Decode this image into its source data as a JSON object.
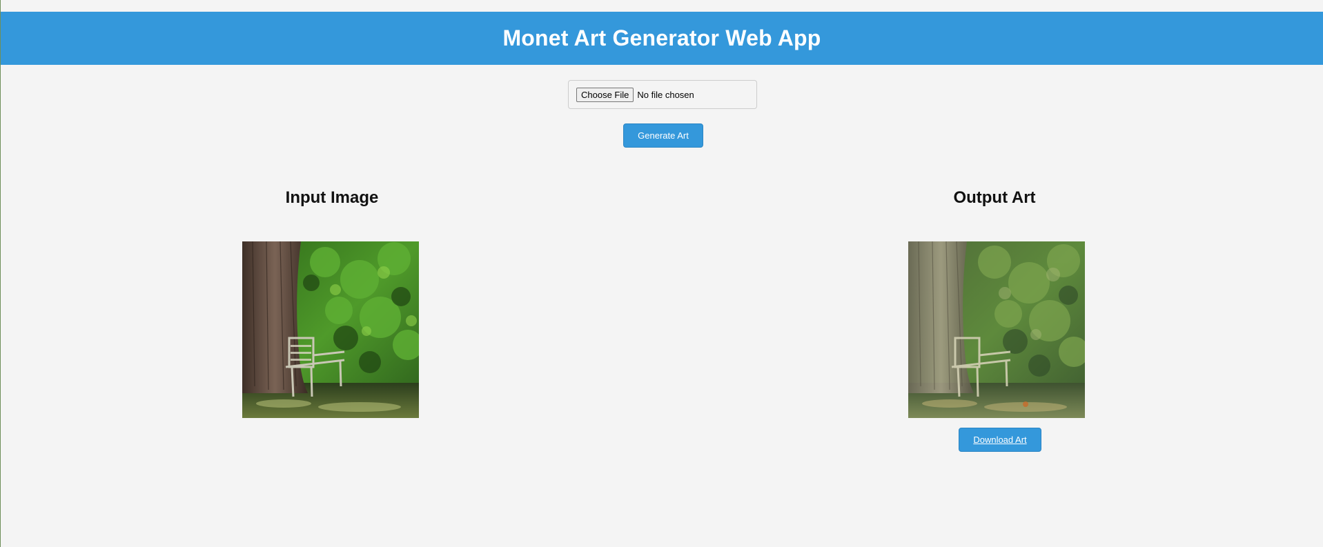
{
  "header": {
    "title": "Monet Art Generator Web App",
    "background": "#3498db"
  },
  "upload": {
    "button_label": "Choose File",
    "status_text": "No file chosen"
  },
  "actions": {
    "generate_label": "Generate Art",
    "download_label": "Download Art",
    "accent_color": "#3498db"
  },
  "panels": {
    "input_title": "Input Image",
    "output_title": "Output Art"
  },
  "images": {
    "input_alt": "photo of a wooden bench under a tree in a green garden",
    "output_alt": "Monet-style painting of a wooden bench under a tree"
  }
}
